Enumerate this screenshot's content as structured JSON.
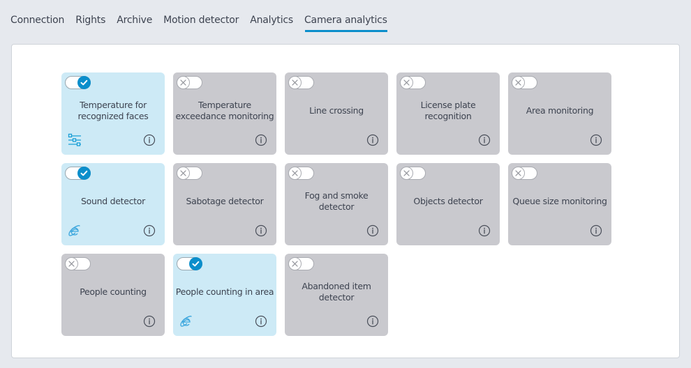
{
  "tabs": [
    {
      "label": "Connection",
      "active": false
    },
    {
      "label": "Rights",
      "active": false
    },
    {
      "label": "Archive",
      "active": false
    },
    {
      "label": "Motion detector",
      "active": false
    },
    {
      "label": "Analytics",
      "active": false
    },
    {
      "label": "Camera analytics",
      "active": true
    }
  ],
  "colors": {
    "accent": "#0b8ecb",
    "card_on": "#cdeaf6",
    "card_off": "#c9c9ce"
  },
  "cards": [
    {
      "label": "Temperature for recognized faces",
      "enabled": true,
      "extra_icon": "settings-sliders-icon"
    },
    {
      "label": "Temperature exceedance monitoring",
      "enabled": false
    },
    {
      "label": "Line crossing",
      "enabled": false
    },
    {
      "label": "License plate recognition",
      "enabled": false
    },
    {
      "label": "Area monitoring",
      "enabled": false
    },
    {
      "label": "Sound detector",
      "enabled": true,
      "extra_icon": "browser-e-icon"
    },
    {
      "label": "Sabotage detector",
      "enabled": false
    },
    {
      "label": "Fog and smoke detector",
      "enabled": false
    },
    {
      "label": "Objects detector",
      "enabled": false
    },
    {
      "label": "Queue size monitoring",
      "enabled": false
    },
    {
      "label": "People counting",
      "enabled": false
    },
    {
      "label": "People counting in area",
      "enabled": true,
      "extra_icon": "browser-e-icon"
    },
    {
      "label": "Abandoned item detector",
      "enabled": false
    }
  ]
}
